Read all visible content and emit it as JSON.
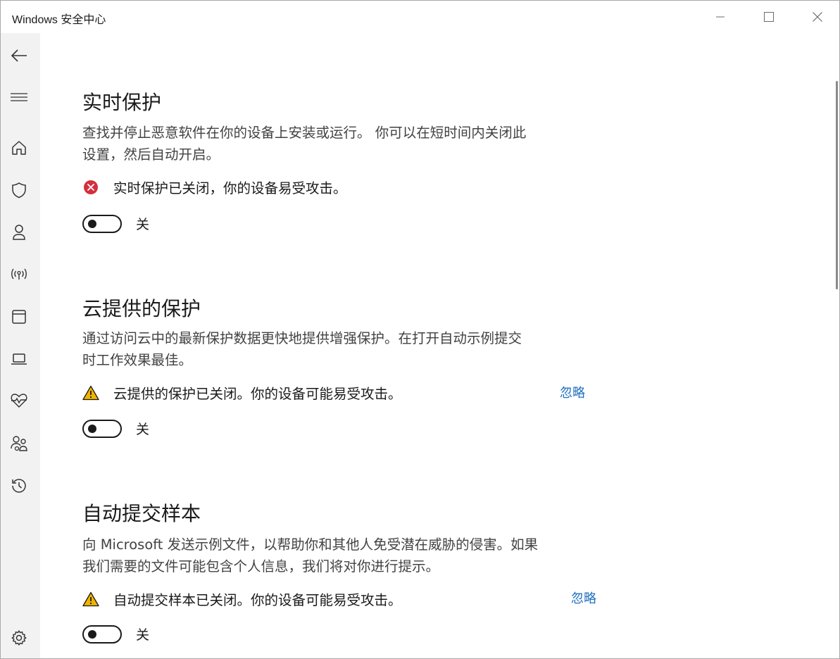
{
  "window": {
    "title": "Windows 安全中心"
  },
  "sidebar": {
    "items": [
      {
        "name": "back",
        "icon": "back-arrow-icon"
      },
      {
        "name": "menu",
        "icon": "hamburger-icon"
      },
      {
        "name": "home",
        "icon": "home-icon"
      },
      {
        "name": "virus-protection",
        "icon": "shield-icon"
      },
      {
        "name": "account-protection",
        "icon": "person-icon"
      },
      {
        "name": "firewall-network",
        "icon": "wireless-icon"
      },
      {
        "name": "app-browser-control",
        "icon": "app-window-icon"
      },
      {
        "name": "device-security",
        "icon": "laptop-icon"
      },
      {
        "name": "device-performance",
        "icon": "heart-pulse-icon"
      },
      {
        "name": "family-options",
        "icon": "family-icon"
      },
      {
        "name": "protection-history",
        "icon": "history-icon"
      },
      {
        "name": "settings",
        "icon": "gear-icon"
      }
    ]
  },
  "sections": [
    {
      "title": "实时保护",
      "desc_lines": [
        "查找并停止恶意软件在你的设备上安装或运行。 你可以在短时间内关闭此",
        "设置，然后自动开启。"
      ],
      "status_icon": "error-circle-icon",
      "status_text": "实时保护已关闭，你的设备易受攻击。",
      "dismiss": "",
      "toggle_state": "关",
      "toggle_on": false
    },
    {
      "title": "云提供的保护",
      "desc_lines": [
        "通过访问云中的最新保护数据更快地提供增强保护。在打开自动示例提交",
        "时工作效果最佳。"
      ],
      "status_icon": "warning-triangle-icon",
      "status_text": "云提供的保护已关闭。你的设备可能易受攻击。",
      "dismiss": "忽略",
      "toggle_state": "关",
      "toggle_on": false
    },
    {
      "title": "自动提交样本",
      "desc_lines": [
        "向 Microsoft 发送示例文件，以帮助你和其他人免受潜在威胁的侵害。如果",
        "我们需要的文件可能包含个人信息，我们将对你进行提示。"
      ],
      "status_icon": "warning-triangle-icon",
      "status_text": "自动提交样本已关闭。你的设备可能易受攻击。",
      "dismiss": "忽略",
      "toggle_state": "关",
      "toggle_on": false
    }
  ],
  "colors": {
    "error": "#d32f3c",
    "warning": "#f0b400",
    "link": "#1f6fbf",
    "sidebar_bg": "#f2f2f2"
  }
}
